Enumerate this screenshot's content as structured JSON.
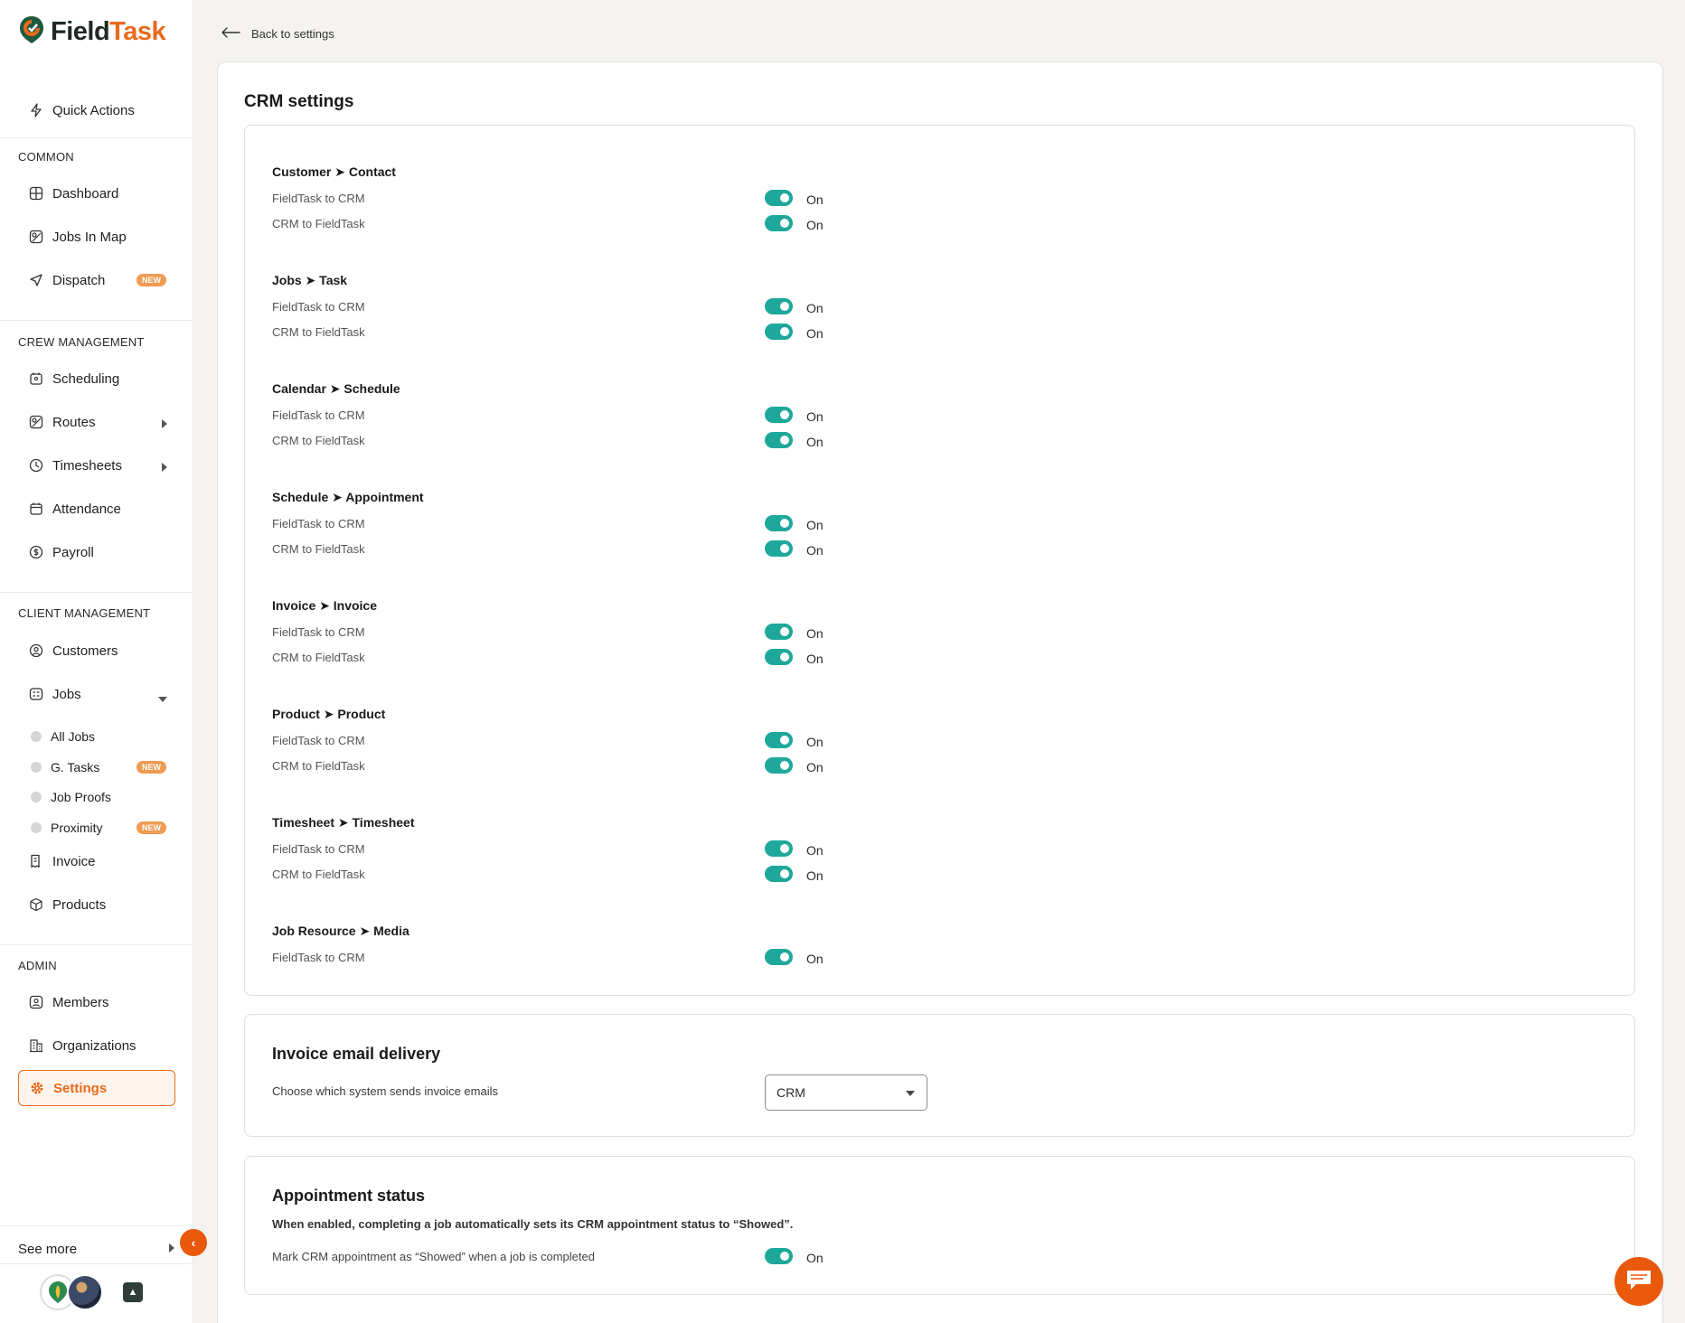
{
  "brand": {
    "name_part1": "Field",
    "name_part2": "Task",
    "accent": "#e86a1c",
    "toggle_color": "#1ea89b"
  },
  "sidebar": {
    "quick_actions": "Quick Actions",
    "sections": {
      "common": "COMMON",
      "crew": "CREW MANAGEMENT",
      "client": "CLIENT MANAGEMENT",
      "admin": "ADMIN"
    },
    "items": {
      "dashboard": "Dashboard",
      "jobs_in_map": "Jobs In Map",
      "dispatch": "Dispatch",
      "scheduling": "Scheduling",
      "routes": "Routes",
      "timesheets": "Timesheets",
      "attendance": "Attendance",
      "payroll": "Payroll",
      "customers": "Customers",
      "jobs": "Jobs",
      "all_jobs": "All Jobs",
      "g_tasks": "G. Tasks",
      "job_proofs": "Job Proofs",
      "proximity": "Proximity",
      "invoice": "Invoice",
      "products": "Products",
      "members": "Members",
      "organizations": "Organizations",
      "settings": "Settings"
    },
    "badge_new": "NEW",
    "see_more": "See more"
  },
  "header": {
    "back_label": "Back to settings"
  },
  "crm": {
    "title": "CRM settings",
    "groups": [
      {
        "title": "Customer ➤ Contact",
        "rows": [
          {
            "label": "FieldTask to CRM",
            "state": "On"
          },
          {
            "label": "CRM to FieldTask",
            "state": "On"
          }
        ]
      },
      {
        "title": "Jobs ➤ Task",
        "rows": [
          {
            "label": "FieldTask to CRM",
            "state": "On"
          },
          {
            "label": "CRM to FieldTask",
            "state": "On"
          }
        ]
      },
      {
        "title": "Calendar ➤ Schedule",
        "rows": [
          {
            "label": "FieldTask to CRM",
            "state": "On"
          },
          {
            "label": "CRM to FieldTask",
            "state": "On"
          }
        ]
      },
      {
        "title": "Schedule ➤ Appointment",
        "rows": [
          {
            "label": "FieldTask to CRM",
            "state": "On"
          },
          {
            "label": "CRM to FieldTask",
            "state": "On"
          }
        ]
      },
      {
        "title": "Invoice ➤ Invoice",
        "rows": [
          {
            "label": "FieldTask to CRM",
            "state": "On"
          },
          {
            "label": "CRM to FieldTask",
            "state": "On"
          }
        ]
      },
      {
        "title": "Product ➤ Product",
        "rows": [
          {
            "label": "FieldTask to CRM",
            "state": "On"
          },
          {
            "label": "CRM to FieldTask",
            "state": "On"
          }
        ]
      },
      {
        "title": "Timesheet ➤ Timesheet",
        "rows": [
          {
            "label": "FieldTask to CRM",
            "state": "On"
          },
          {
            "label": "CRM to FieldTask",
            "state": "On"
          }
        ]
      },
      {
        "title": "Job Resource ➤ Media",
        "rows": [
          {
            "label": "FieldTask to CRM",
            "state": "On"
          }
        ]
      }
    ]
  },
  "invoice_email": {
    "title": "Invoice email delivery",
    "description": "Choose which system sends invoice emails",
    "selected": "CRM"
  },
  "appointment_status": {
    "title": "Appointment status",
    "description": "When enabled, completing a job automatically sets its CRM appointment status to “Showed”.",
    "row_label": "Mark CRM appointment as “Showed” when a job is completed",
    "state": "On"
  }
}
